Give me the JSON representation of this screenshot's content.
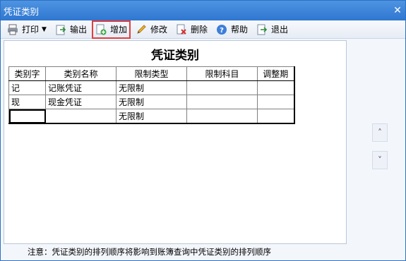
{
  "window": {
    "title": "凭证类别",
    "close_glyph": "✕"
  },
  "toolbar": {
    "items": [
      {
        "label": "打印",
        "icon": "printer-icon",
        "has_dropdown": true
      },
      {
        "label": "输出",
        "icon": "export-icon"
      },
      {
        "label": "增加",
        "icon": "add-icon",
        "highlighted": true
      },
      {
        "label": "修改",
        "icon": "edit-icon"
      },
      {
        "label": "删除",
        "icon": "delete-icon"
      },
      {
        "label": "帮助",
        "icon": "help-icon"
      },
      {
        "label": "退出",
        "icon": "exit-icon"
      }
    ],
    "highlight_color": "#e53c3c"
  },
  "main": {
    "heading": "凭证类别",
    "columns": [
      "类别字",
      "类别名称",
      "限制类型",
      "限制科目",
      "调整期"
    ],
    "rows": [
      [
        "记",
        "记账凭证",
        "无限制",
        "",
        ""
      ],
      [
        "现",
        "现金凭证",
        "无限制",
        "",
        ""
      ],
      [
        "",
        "",
        "无限制",
        "",
        ""
      ]
    ]
  },
  "nav": {
    "up_glyph": "˄",
    "down_glyph": "˅"
  },
  "footer": {
    "note": "注意：凭证类别的排列顺序将影响到账簿查询中凭证类别的排列顺序"
  }
}
